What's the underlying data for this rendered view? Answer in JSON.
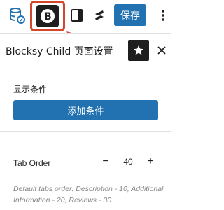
{
  "toolbar": {
    "save_label": "保存",
    "icons": [
      "database-icon",
      "blocksy-icon",
      "sidebar-toggle-icon",
      "stackable-icon",
      "more-vertical-icon"
    ],
    "highlight_color": "#d2472b",
    "accent_color": "#2271b1"
  },
  "panel": {
    "title": "Blocksy Child 页面设置",
    "star_icon": "star-icon",
    "close_icon": "close-icon"
  },
  "conditions": {
    "label": "显示条件",
    "add_button_label": "添加条件"
  },
  "tab_order": {
    "label": "Tab Order",
    "value": "40",
    "minus_label": "−",
    "plus_label": "+",
    "help": "Default tabs order: Description - 10, Additional Information - 20, Reviews - 30."
  }
}
